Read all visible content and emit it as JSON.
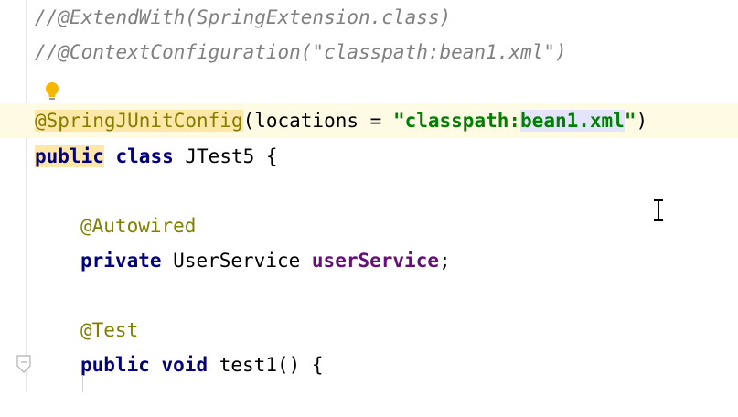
{
  "editor": {
    "lines": {
      "l1": {
        "comment": "//@ExtendWith(SpringExtension.class)"
      },
      "l2": {
        "comment": "//@ContextConfiguration(\"classpath:bean1.xml\")"
      },
      "l4": {
        "annotation": "@SpringJUnitConfig",
        "open": "(locations = ",
        "str_start": "\"classpath:",
        "str_sel": "bean1.xml",
        "str_end": "\"",
        "close": ")"
      },
      "l5": {
        "kw_public": "public",
        "kw_class": "class",
        "classname": "JTest5 {"
      },
      "l7": {
        "annotation": "@Autowired"
      },
      "l8": {
        "kw_private": "private",
        "type": "UserService",
        "field": "userService",
        "semi": ";"
      },
      "l10": {
        "annotation": "@Test"
      },
      "l11": {
        "kw_public": "public",
        "kw_void": "void",
        "method": "test1() {"
      }
    }
  },
  "icons": {
    "bulb": "lightbulb-icon",
    "cursor": "text-cursor-icon",
    "fold": "fold-marker-icon"
  }
}
